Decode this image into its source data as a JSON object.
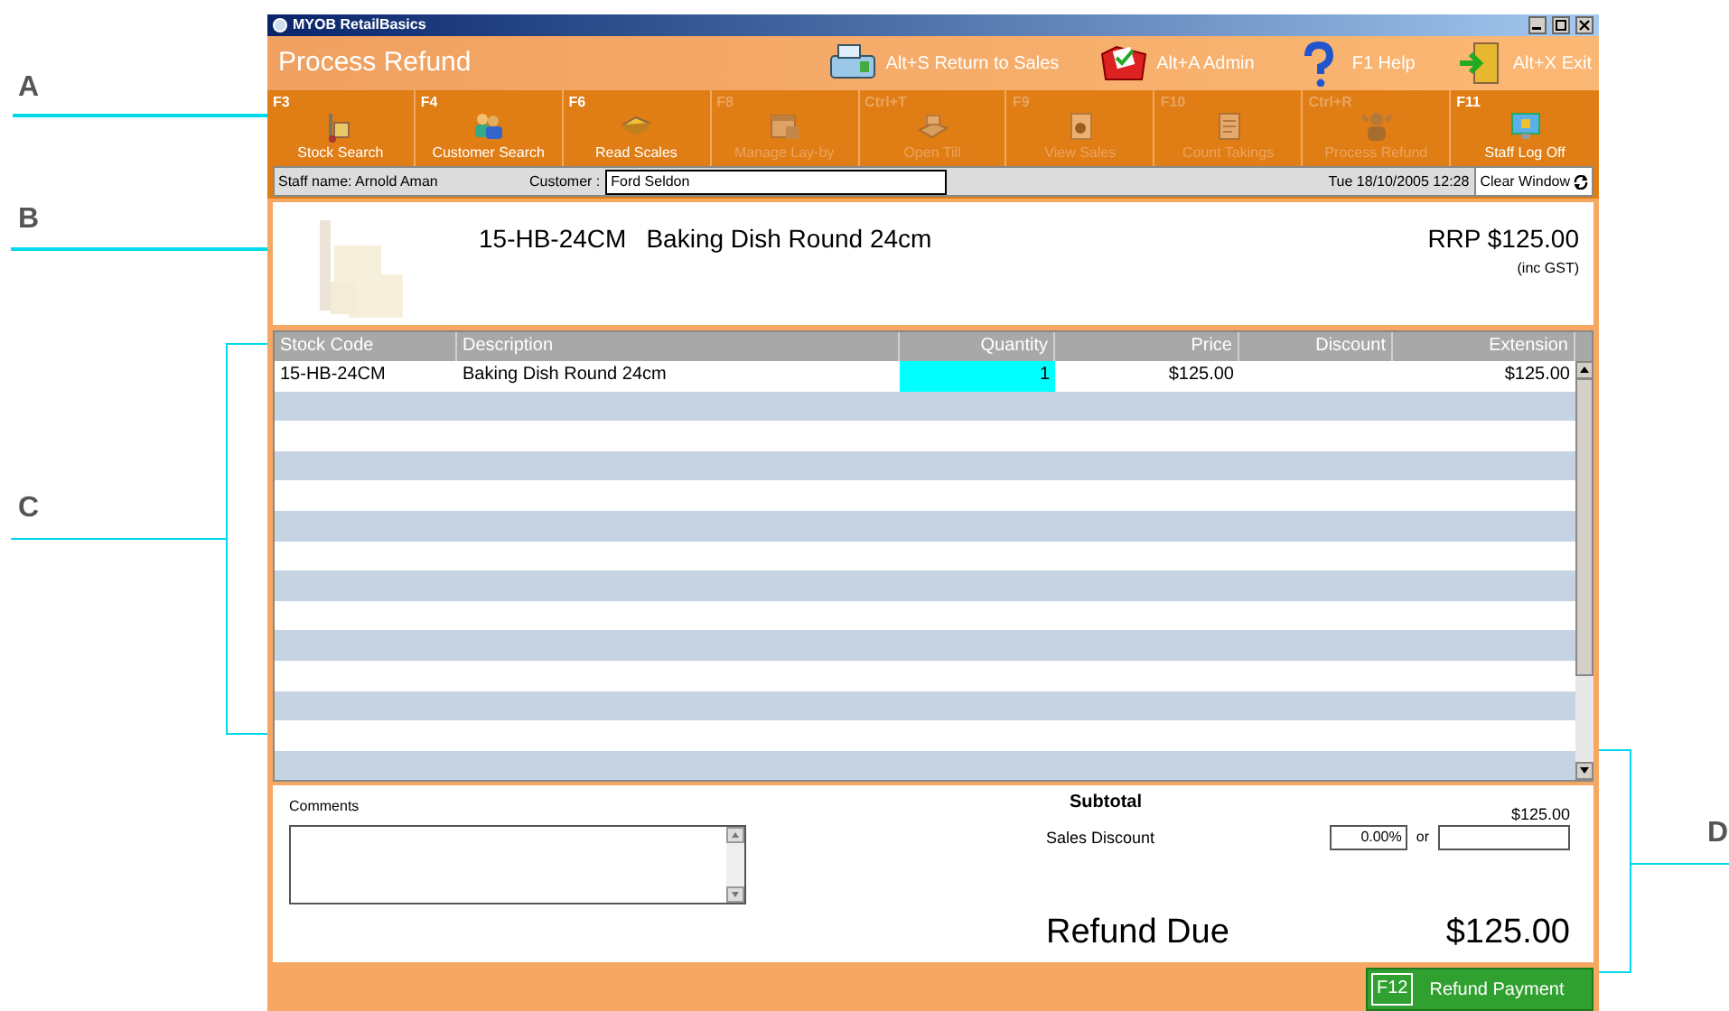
{
  "annotations": [
    {
      "label": "A"
    },
    {
      "label": "B"
    },
    {
      "label": "C"
    },
    {
      "label": "D"
    }
  ],
  "window": {
    "title": "MYOB RetailBasics"
  },
  "header": {
    "title": "Process Refund",
    "shortcuts": [
      {
        "kind": "register",
        "label": "Alt+S Return to Sales"
      },
      {
        "kind": "folder",
        "label": "Alt+A Admin"
      },
      {
        "kind": "help",
        "label": "F1 Help"
      },
      {
        "kind": "exit",
        "label": "Alt+X Exit"
      }
    ]
  },
  "toolbar": [
    {
      "kind": "stock",
      "key": "F3",
      "label": "Stock Search",
      "disabled": false
    },
    {
      "kind": "customer",
      "key": "F4",
      "label": "Customer Search",
      "disabled": false
    },
    {
      "kind": "scales",
      "key": "F6",
      "label": "Read Scales",
      "disabled": false
    },
    {
      "kind": "layby",
      "key": "F8",
      "label": "Manage Lay-by",
      "disabled": true
    },
    {
      "kind": "till",
      "key": "Ctrl+T",
      "label": "Open Till",
      "disabled": true
    },
    {
      "kind": "sales",
      "key": "F9",
      "label": "View Sales",
      "disabled": true
    },
    {
      "kind": "takings",
      "key": "F10",
      "label": "Count Takings",
      "disabled": true
    },
    {
      "kind": "refund",
      "key": "Ctrl+R",
      "label": "Process Refund",
      "disabled": true
    },
    {
      "kind": "logoff",
      "key": "F11",
      "label": "Staff Log Off",
      "disabled": false
    }
  ],
  "info_bar": {
    "staff": "Staff name: Arnold Aman",
    "customer_label": "Customer :",
    "customer": "Ford Seldon",
    "datetime": "Tue 18/10/2005 12:28",
    "clear_button": "Clear Window"
  },
  "product": {
    "code": "15-HB-24CM",
    "name": "Baking Dish Round 24cm",
    "rrp": "RRP $125.00",
    "tax_note": "(inc GST)"
  },
  "table": {
    "columns": [
      {
        "label": "Stock Code"
      },
      {
        "label": "Description"
      },
      {
        "label": "Quantity"
      },
      {
        "label": "Price"
      },
      {
        "label": "Discount"
      },
      {
        "label": "Extension"
      }
    ],
    "rows": [
      {
        "stock_code": "15-HB-24CM",
        "description": "Baking Dish Round 24cm",
        "quantity": "1",
        "quantity_focused": true,
        "price": "$125.00",
        "extension": "$125.00"
      }
    ]
  },
  "totals": {
    "comments_label": "Comments",
    "subtotal_label": "Subtotal",
    "subtotal": "$125.00",
    "discount_label": "Sales Discount",
    "discount_percent": "0.00%",
    "or": "or",
    "due_label": "Refund Due",
    "due": "$125.00"
  },
  "action": {
    "key": "F12",
    "label": "Refund Payment"
  }
}
